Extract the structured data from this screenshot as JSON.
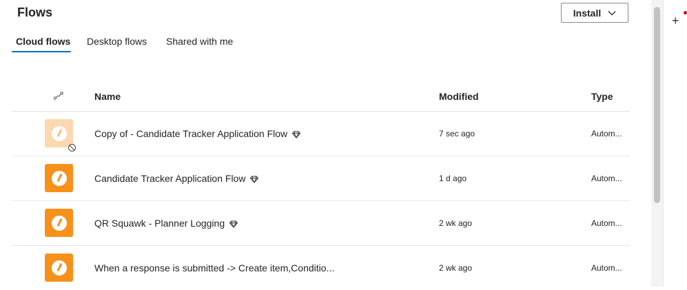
{
  "page": {
    "title": "Flows"
  },
  "toolbar": {
    "install_label": "Install"
  },
  "tabs": [
    {
      "label": "Cloud flows",
      "active": true
    },
    {
      "label": "Desktop flows",
      "active": false
    },
    {
      "label": "Shared with me",
      "active": false
    }
  ],
  "table": {
    "columns": {
      "icon": "flow-type-icon",
      "name": "Name",
      "modified": "Modified",
      "type": "Type"
    },
    "rows": [
      {
        "name": "Copy of - Candidate Tracker Application Flow",
        "modified": "7 sec ago",
        "type": "Autom...",
        "disabled": true,
        "premium": true
      },
      {
        "name": "Candidate Tracker Application Flow",
        "modified": "1 d ago",
        "type": "Autom...",
        "disabled": false,
        "premium": true
      },
      {
        "name": "QR Squawk - Planner Logging",
        "modified": "2 wk ago",
        "type": "Autom...",
        "disabled": false,
        "premium": true
      },
      {
        "name": "When a response is submitted -> Create item,Conditio...",
        "modified": "2 wk ago",
        "type": "Autom...",
        "disabled": false,
        "premium": false
      }
    ]
  },
  "colors": {
    "accent": "#0f6cbd",
    "flow_orange": "#f7911b",
    "flow_orange_disabled": "#fbd8b0",
    "notification": "#c50f1f"
  }
}
